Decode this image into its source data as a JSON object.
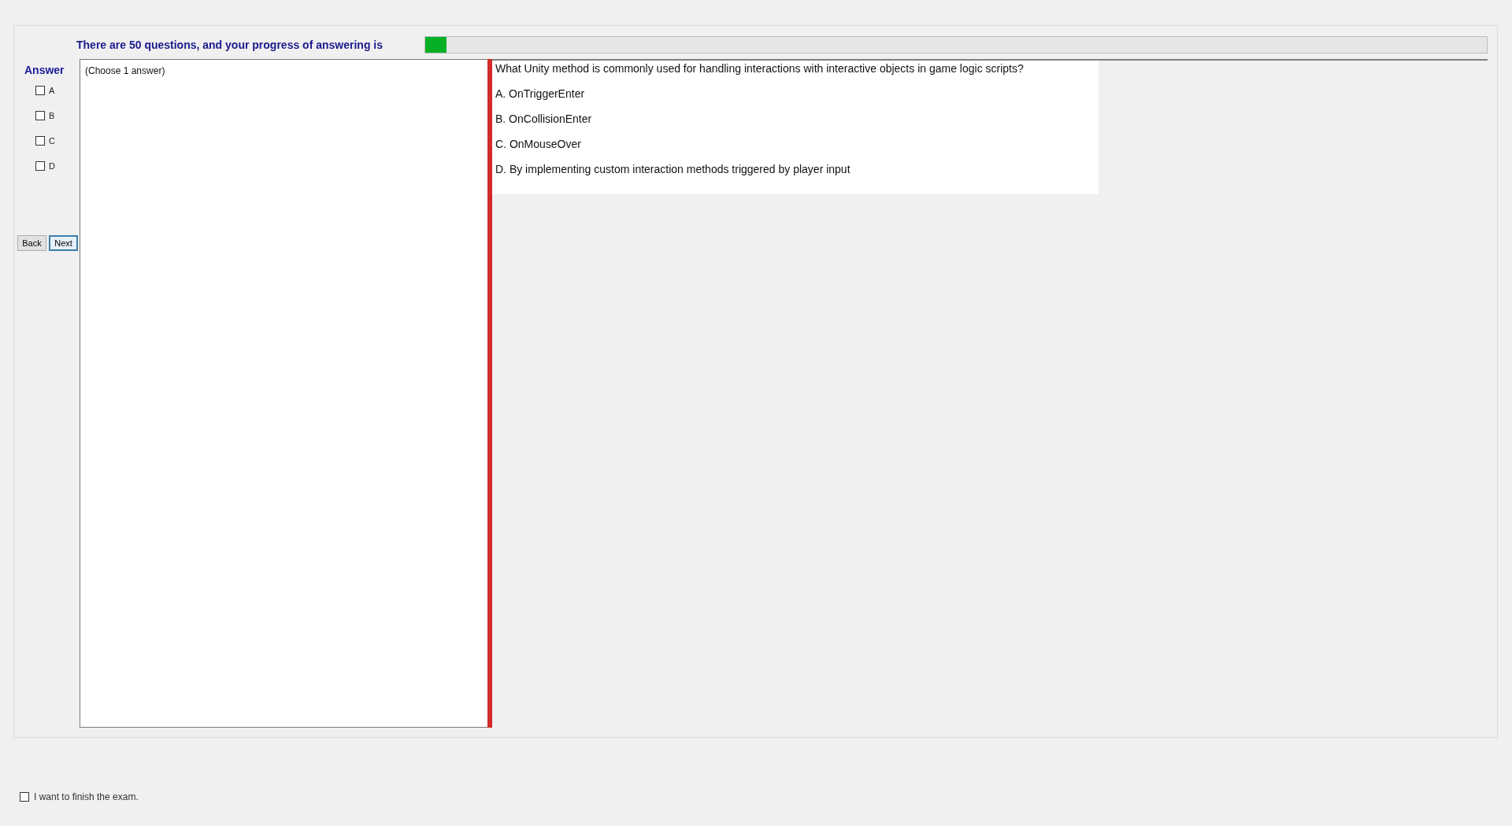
{
  "progress": {
    "label": "There are 50 questions, and your progress of answering is",
    "level": 0.02
  },
  "answer_panel": {
    "title": "Answer",
    "options": [
      {
        "label": "A",
        "checked": false
      },
      {
        "label": "B",
        "checked": false
      },
      {
        "label": "C",
        "checked": false
      },
      {
        "label": "D",
        "checked": false
      }
    ],
    "buttons": [
      {
        "label": "Back",
        "focused": false
      },
      {
        "label": "Next",
        "focused": true
      }
    ]
  },
  "instruction": "(Choose 1 answer)",
  "question": {
    "text": "What Unity method is commonly used for handling interactions with interactive objects in game logic scripts?",
    "choices": [
      "A.  OnTriggerEnter",
      "B.  OnCollisionEnter",
      "C.  OnMouseOver",
      "D.  By implementing custom interaction methods triggered by player input"
    ]
  },
  "finish": {
    "label": "I want to finish the exam.",
    "checked": false
  }
}
